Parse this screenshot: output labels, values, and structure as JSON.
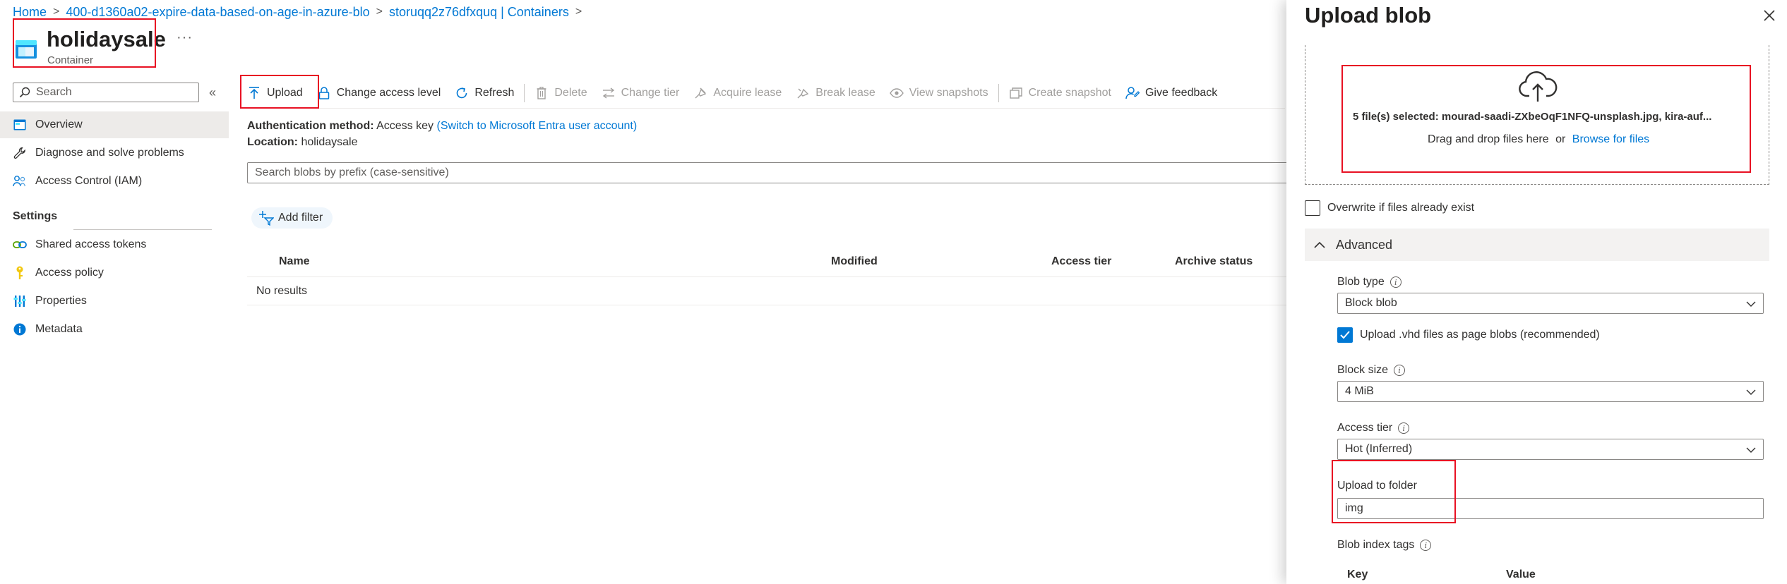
{
  "breadcrumb": {
    "items": [
      "Home",
      "400-d1360a02-expire-data-based-on-age-in-azure-blo",
      "storuqq2z76dfxquq | Containers"
    ],
    "separator": ">"
  },
  "header": {
    "title": "holidaysale",
    "subtitle": "Container",
    "more": "···"
  },
  "sidebar": {
    "search_placeholder": "Search",
    "collapse_glyph": "«",
    "items": [
      {
        "label": "Overview",
        "icon": "overview-icon"
      },
      {
        "label": "Diagnose and solve problems",
        "icon": "wrench-icon"
      },
      {
        "label": "Access Control (IAM)",
        "icon": "people-icon"
      }
    ],
    "settings_heading": "Settings",
    "settings_items": [
      {
        "label": "Shared access tokens",
        "icon": "link-icon"
      },
      {
        "label": "Access policy",
        "icon": "key-icon"
      },
      {
        "label": "Properties",
        "icon": "properties-icon"
      },
      {
        "label": "Metadata",
        "icon": "info-icon"
      }
    ]
  },
  "toolbar": {
    "upload": "Upload",
    "change_access_level": "Change access level",
    "refresh": "Refresh",
    "delete": "Delete",
    "change_tier": "Change tier",
    "acquire_lease": "Acquire lease",
    "break_lease": "Break lease",
    "view_snapshots": "View snapshots",
    "create_snapshot": "Create snapshot",
    "give_feedback": "Give feedback"
  },
  "main": {
    "auth_label": "Authentication method:",
    "auth_value": "Access key",
    "auth_link": "(Switch to Microsoft Entra user account)",
    "location_label": "Location:",
    "location_value": "holidaysale",
    "search_placeholder": "Search blobs by prefix (case-sensitive)",
    "add_filter": "Add filter",
    "columns": [
      "Name",
      "Modified",
      "Access tier",
      "Archive status"
    ],
    "empty_text": "No results"
  },
  "panel": {
    "title": "Upload blob",
    "files_selected": "5 file(s) selected: mourad-saadi-ZXbeOqF1NFQ-unsplash.jpg, kira-auf...",
    "drag_text": "Drag and drop files here",
    "or_text": "or",
    "browse_link": "Browse for files",
    "overwrite_label": "Overwrite if files already exist",
    "overwrite_checked": false,
    "advanced_label": "Advanced",
    "blob_type_label": "Blob type",
    "blob_type_value": "Block blob",
    "vhd_label": "Upload .vhd files as page blobs (recommended)",
    "vhd_checked": true,
    "block_size_label": "Block size",
    "block_size_value": "4 MiB",
    "access_tier_label": "Access tier",
    "access_tier_value": "Hot (Inferred)",
    "upload_folder_label": "Upload to folder",
    "upload_folder_value": "img",
    "index_tags_label": "Blob index tags",
    "tag_key_header": "Key",
    "tag_value_header": "Value",
    "info_glyph": "i"
  },
  "colors": {
    "accent": "#0078d4",
    "highlight_box": "#e81123",
    "selected_nav": "#edebe9",
    "text": "#323130",
    "disabled": "#a19f9d"
  }
}
